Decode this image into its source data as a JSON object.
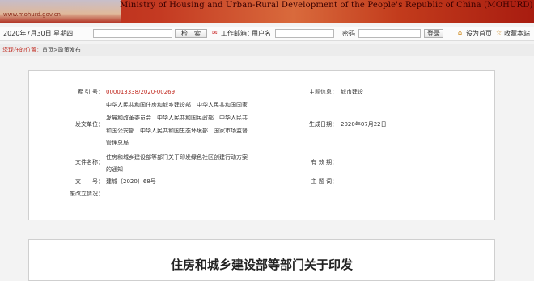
{
  "banner": {
    "url": "www.mohurd.gov.cn",
    "ministry": "Ministry of Housing and Urban-Rural Development of the People's Republic of China (MOHURD)"
  },
  "toolbar": {
    "date": "2020年7月30日 星期四",
    "search_button": "检　索",
    "work_label": "工作邮箱：",
    "username_placeholder": "用户名",
    "password_label": "密码",
    "login_button": "登录",
    "set_home": "设为首页",
    "bookmark": "收藏本站"
  },
  "breadcrumb": {
    "location_label": "您现在的位置：",
    "home": "首页",
    "sep": ">",
    "section": "政策发布"
  },
  "meta": {
    "index_label": "索 引 号：",
    "index_value": "000013338/2020-00269",
    "topic_label": "主题信息：",
    "topic_value": "城市建设",
    "issuer_label": "发文单位：",
    "issuer_lines": [
      "中华人民共和国住房和城乡建设部　中华人民共和国国家",
      "发展和改革委员会　中华人民共和国民政部　中华人民共",
      "和国公安部　中华人民共和国生态环境部　国家市场监督",
      "管理总局"
    ],
    "date_label": "生成日期：",
    "date_value": "2020年07月22日",
    "docname_label": "文件名称：",
    "docname_lines": [
      "住房和城乡建设部等部门关于印发绿色社区创建行动方案",
      "的通知"
    ],
    "validity_label": "有 效 期：",
    "validity_value": "",
    "number_label": "文　　号：",
    "number_value": "建城〔2020〕68号",
    "keywords_label": "主 题 词：",
    "keywords_value": "",
    "interpret_label": "废改立情况："
  },
  "document": {
    "title": "住房和城乡建设部等部门关于印发"
  }
}
